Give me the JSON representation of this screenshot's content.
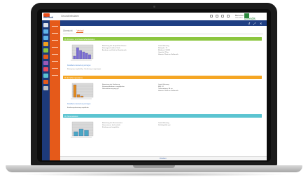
{
  "app": {
    "logo_text": "iMelSuit",
    "title": "Gesundheitsdaten",
    "user_name": "Benutzer",
    "user_sub": "Abmelden",
    "brand_text": "dimedis"
  },
  "tabs": [
    {
      "label": "Übersicht",
      "active": false
    },
    {
      "label": "Verlauf",
      "active": true
    }
  ],
  "window_controls": [
    "↺",
    "⤢",
    "✕"
  ],
  "sections": [
    {
      "title": "Ihr Fitness- und Gesundheitsstatus",
      "color": "#8cc63f",
      "info_left": [
        "Bewertung der körperlichen Fitness",
        "Fitnessgrad: mittlere Stufe",
        "Ausdauer und Kraft im Normbereich"
      ],
      "info_right": [
        "Letzte Messung",
        "Ruhepuls: 72",
        "Blutdruck: 120/80",
        "Gewicht: 78 kg",
        "Hinweis: Werte im Zielbereich"
      ],
      "link": "Detaillierte Auswertung anzeigen",
      "note": "Bewegung: regelmäßig · Ernährung: ausgewogen",
      "chart": {
        "type": "bar",
        "values": [
          2,
          8,
          6,
          5,
          4,
          3
        ],
        "ylim": [
          0,
          10
        ],
        "color": "#7b6cd4"
      }
    },
    {
      "title": "Ihr Ernährungsstatus",
      "color": "#f5a623",
      "info_left": [
        "Bewertung der Ernährung",
        "Kalorienaufnahme: ausgeglichen",
        "Nährstoffversorgung gut"
      ],
      "info_right": [
        "Letzte Messung",
        "BMI: 24",
        "Taillenumfang: 88 cm",
        "Hinweis: Werte im Zielbereich"
      ],
      "link": "Detaillierte Auswertung anzeigen",
      "note": "Ernährungsberatung empfohlen",
      "chart": {
        "type": "bar",
        "values": [
          9,
          2,
          1,
          0,
          0
        ],
        "ylim": [
          0,
          10
        ],
        "color": "#e08a1e"
      }
    },
    {
      "title": "Ihr Stressstatus",
      "color": "#5bc4d1",
      "info_left": [
        "Bewertung des Stressniveaus",
        "Stressniveau: leicht erhöht",
        "Erholung wird empfohlen"
      ],
      "info_right": [
        "Letzte Messung",
        "Schlafqualität: gut"
      ],
      "link": "",
      "note": "",
      "chart": {
        "type": "bar",
        "values": [
          3,
          5,
          4
        ],
        "ylim": [
          0,
          10
        ],
        "color": "#4aa6c4"
      }
    }
  ],
  "footer": {
    "label": "Drucken"
  }
}
